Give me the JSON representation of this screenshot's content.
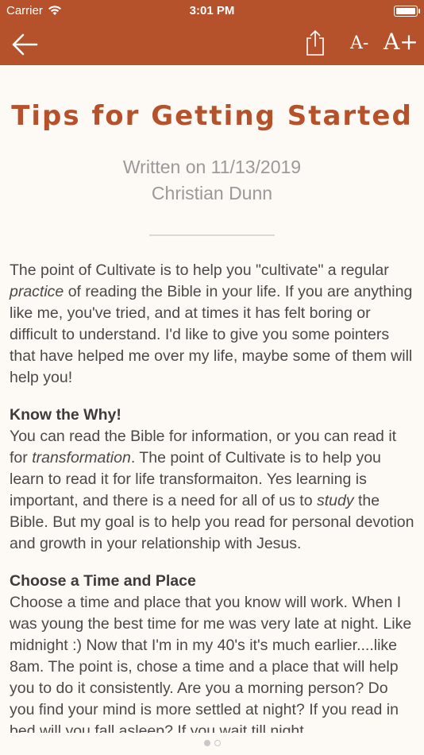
{
  "status": {
    "carrier": "Carrier",
    "time": "3:01 PM"
  },
  "toolbar": {
    "font_smaller": "A-",
    "font_larger": "A+"
  },
  "article": {
    "title": "Tips for Getting Started",
    "written_on": "Written on 11/13/2019",
    "author": "Christian Dunn",
    "intro_1": "The point of Cultivate is to help you \"cultivate\" a regular ",
    "intro_em": "practice",
    "intro_2": " of reading the Bible in your life. If you are anything like me, you've tried, and at times it has felt boring or difficult to understand. I'd like to give you some pointers that have helped me over my life, maybe some of them will help you!",
    "s1_heading": "Know the Why!",
    "s1_a": "You can read the Bible for information, or you can read it for ",
    "s1_em1": "transformation",
    "s1_b": ". The point of Cultivate is to help you learn to read it for life transformaiton. Yes learning is important, and there is a need for all of us to ",
    "s1_em2": "study",
    "s1_c": " the Bible. But my goal is to help you read for personal devotion and growth in your relationship with Jesus.",
    "s2_heading": "Choose a Time and Place",
    "s2_text": "Choose a time and place that you know will work. When I was young the best time for me was very late at night. Like midnight :) Now that I'm in my 40's it's much earlier....like 8am. The point is, chose a time and a place that will help you to do it consistently. Are you a morning person? Do you find your mind is more settled at night? If you read in bed will you fall asleep? If you wait till night"
  },
  "pager": {
    "count": 2,
    "active": 1
  },
  "colors": {
    "accent": "#b5522b",
    "background": "#fdf9f4"
  }
}
